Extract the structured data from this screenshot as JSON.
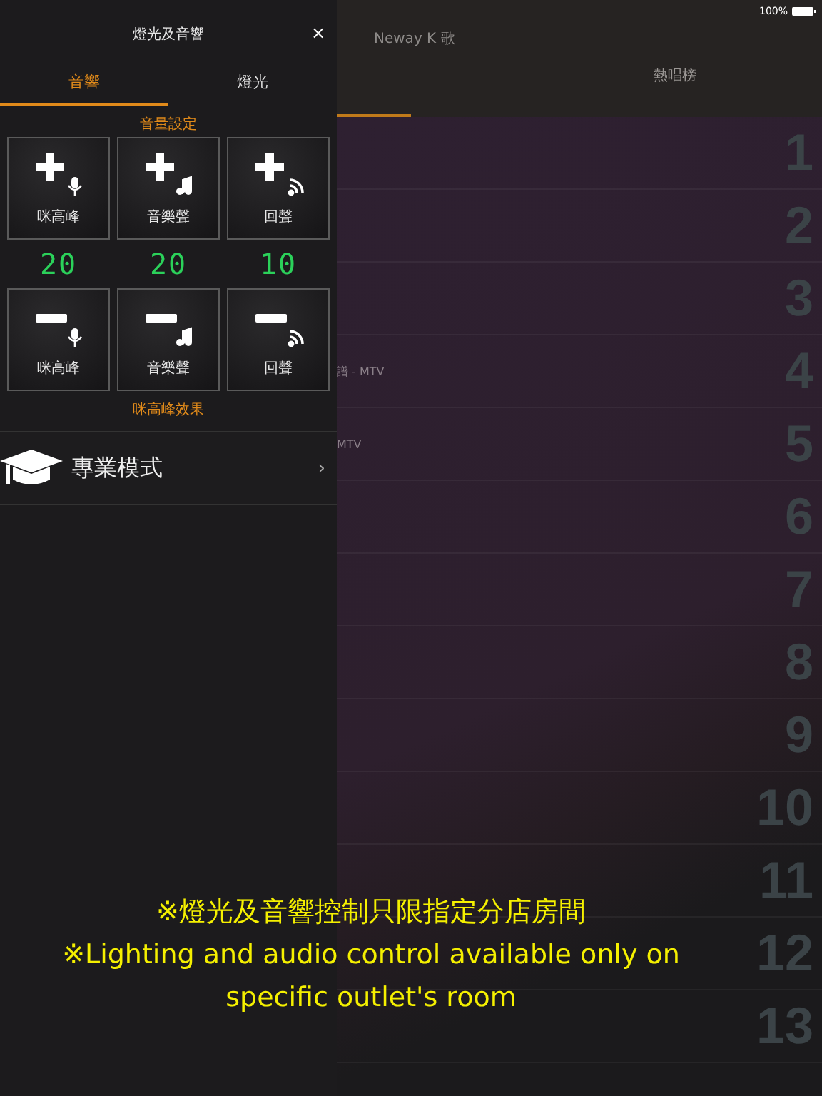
{
  "status_bar": {
    "battery": "100%"
  },
  "app": {
    "title": "Neway K 歌",
    "tabs": [
      {
        "label": "熱唱榜",
        "selected": false
      }
    ]
  },
  "song_rows": [
    {
      "rank": "1"
    },
    {
      "rank": "2"
    },
    {
      "rank": "3"
    },
    {
      "rank": "4",
      "title": "譜 - MTV"
    },
    {
      "rank": "5",
      "title": "MTV"
    },
    {
      "rank": "6"
    },
    {
      "rank": "7"
    },
    {
      "rank": "8"
    },
    {
      "rank": "9"
    },
    {
      "rank": "10"
    },
    {
      "rank": "11"
    },
    {
      "rank": "12"
    },
    {
      "rank": "13"
    }
  ],
  "drawer": {
    "title": "燈光及音響",
    "close": "×",
    "tabs": [
      {
        "label": "音響",
        "selected": true
      },
      {
        "label": "燈光",
        "selected": false
      }
    ],
    "volume_heading": "音量設定",
    "increase_buttons": [
      {
        "kind": "mic",
        "label": "咪高峰"
      },
      {
        "kind": "music",
        "label": "音樂聲"
      },
      {
        "kind": "echo",
        "label": "回聲"
      }
    ],
    "readings": [
      "20",
      "20",
      "10"
    ],
    "decrease_buttons": [
      {
        "kind": "mic",
        "label": "咪高峰"
      },
      {
        "kind": "music",
        "label": "音樂聲"
      },
      {
        "kind": "echo",
        "label": "回聲"
      }
    ],
    "effects_heading": "咪高峰效果",
    "menu_items": [
      {
        "label": "專業模式",
        "chevron": "›"
      }
    ]
  },
  "caption": [
    "※燈光及音響控制只限指定分店房間",
    "※Lighting and audio control available only on",
    "specific outlet's room"
  ]
}
